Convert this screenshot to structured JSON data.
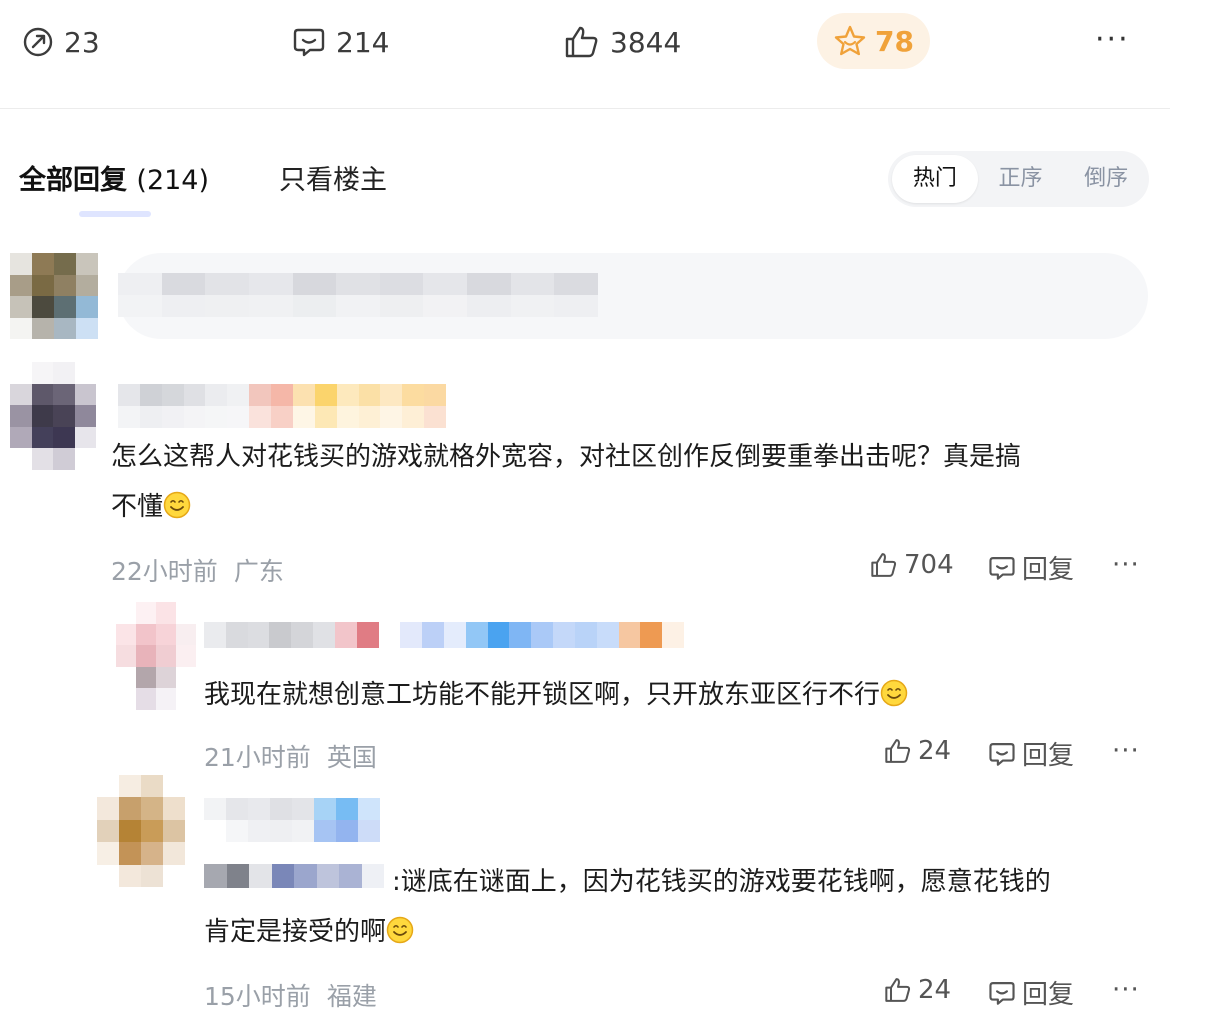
{
  "top_bar": {
    "share_count": "23",
    "comment_count": "214",
    "like_count": "3844",
    "favorite_count": "78",
    "more": "···"
  },
  "tabs": {
    "all_label": "全部回复",
    "all_count": "(214)",
    "op_only": "只看楼主"
  },
  "sort": [
    "热门",
    "正序",
    "倒序"
  ],
  "comments": [
    {
      "text_line1": "怎么这帮人对花钱买的游戏就格外宽容，对社区创作反倒要重拳出击呢？真是搞",
      "text_line2": "不懂",
      "time": "22小时前",
      "location": "广东",
      "likes": "704",
      "reply_label": "回复",
      "more": "···"
    },
    {
      "text_line1": "我现在就想创意工坊能不能开锁区啊，只开放东亚区行不行",
      "time": "21小时前",
      "location": "英国",
      "likes": "24",
      "reply_label": "回复",
      "more": "···"
    },
    {
      "text_line1": ":谜底在谜面上，因为花钱买的游戏要花钱啊，愿意花钱的",
      "text_line2": "肯定是接受的啊",
      "time": "15小时前",
      "location": "福建",
      "likes": "24",
      "reply_label": "回复",
      "more": "···"
    }
  ]
}
